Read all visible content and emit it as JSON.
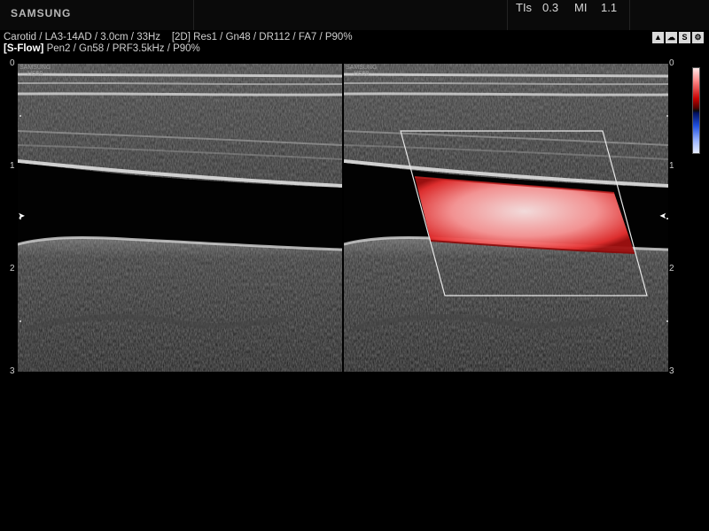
{
  "header": {
    "brand": "SAMSUNG",
    "tis_label": "TIs",
    "tis_value": "0.3",
    "mi_label": "MI",
    "mi_value": "1.1"
  },
  "info_lines": {
    "line1": "Carotid / LA3-14AD / 3.0cm / 33Hz",
    "line1_mode": "[2D]",
    "line1_params": "Res1 / Gn48 / DR112 / FA7 / P90%",
    "line2_mode": "[S-Flow]",
    "line2_params": "Pen2 / Gn58 / PRF3.5kHz / P90%"
  },
  "status_icons": [
    "person-icon",
    "cloud-icon",
    "s-har-icon",
    "gear-icon"
  ],
  "status_icon_labels": {
    "s_har": "S"
  },
  "watermark": {
    "line1": "SAMSUNG",
    "line2": "HS50"
  },
  "depth_scale": [
    "0",
    "1",
    "2",
    "3"
  ],
  "colors": {
    "flow_red": "#ff3a3a",
    "flow_highlight": "#ffe6e6",
    "background": "#000000"
  }
}
